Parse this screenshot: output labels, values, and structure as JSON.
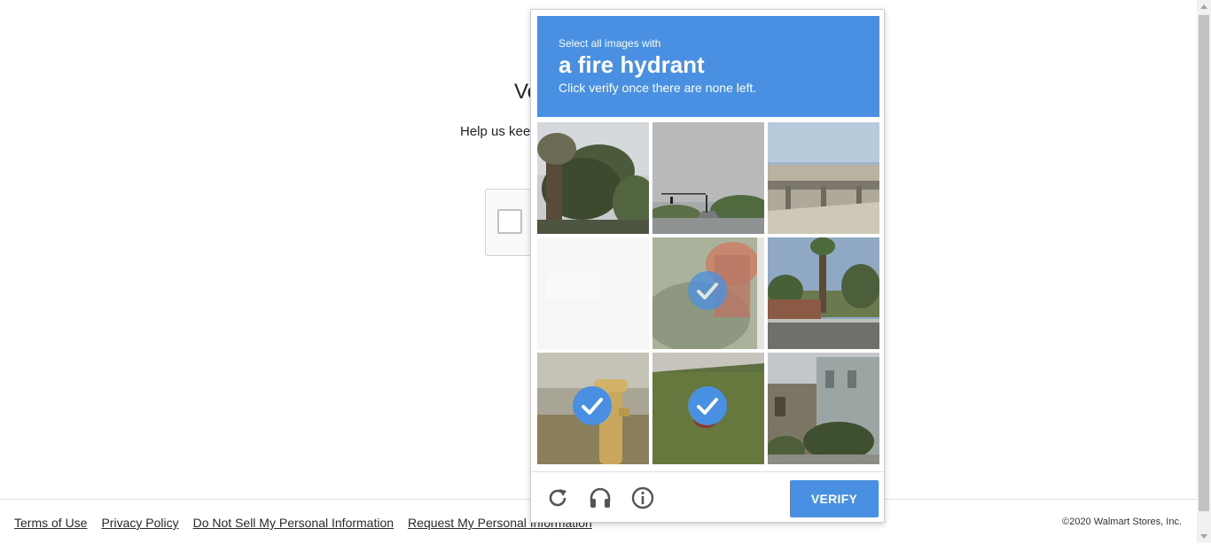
{
  "page": {
    "heading": "Ve",
    "subtext": "Help us kee"
  },
  "footer": {
    "links": [
      "Terms of Use",
      "Privacy Policy",
      "Do Not Sell My Personal Information",
      "Request My Personal Information"
    ],
    "copyright": "©2020 Walmart Stores, Inc."
  },
  "challenge": {
    "instruction": "Select all images with",
    "target": "a fire hydrant",
    "hint": "Click verify once there are none left.",
    "header_color": "#4a90e2",
    "tiles": [
      {
        "scene": "palm-trees",
        "selected": false
      },
      {
        "scene": "road-with-traffic-light",
        "selected": false
      },
      {
        "scene": "highway-overpass",
        "selected": false
      },
      {
        "scene": "blank-white",
        "selected": false
      },
      {
        "scene": "red-fire-hydrant-closeup",
        "selected": true
      },
      {
        "scene": "street-with-palm-trees",
        "selected": false
      },
      {
        "scene": "yellow-fire-hydrant",
        "selected": true
      },
      {
        "scene": "grass-with-red-hydrant",
        "selected": true
      },
      {
        "scene": "houses-with-trees",
        "selected": false
      }
    ],
    "verify_label": "VERIFY",
    "icons": [
      "reload-icon",
      "audio-icon",
      "info-icon"
    ]
  }
}
